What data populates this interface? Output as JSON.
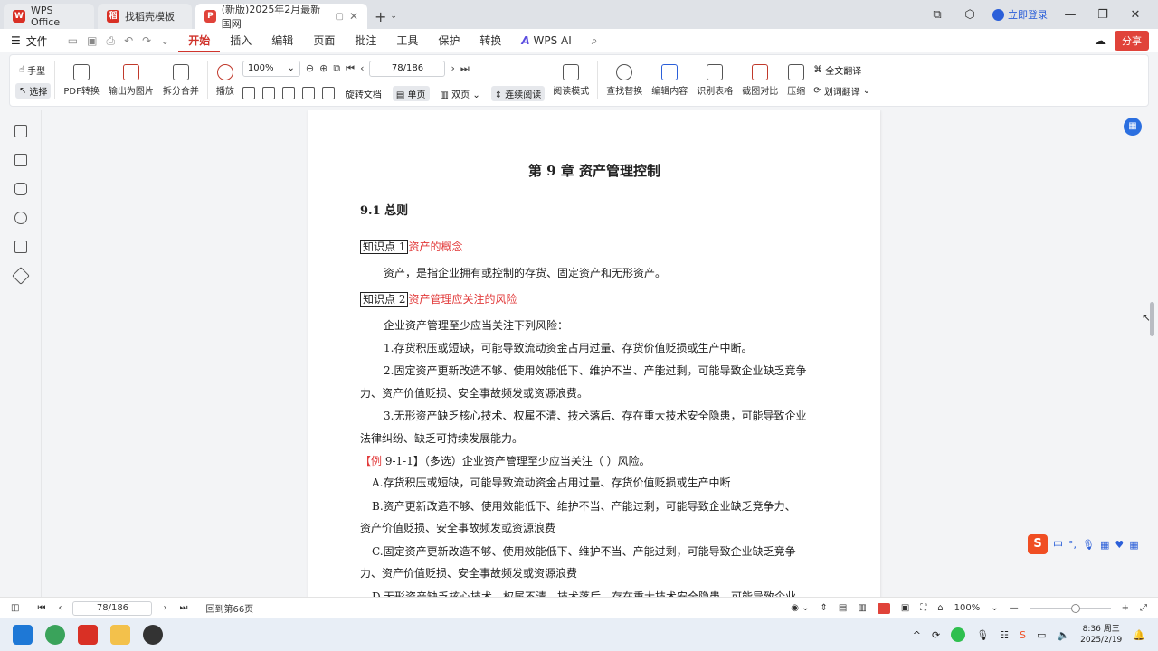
{
  "tabs": [
    {
      "label": "WPS Office",
      "logo": "W",
      "color": "#d93025"
    },
    {
      "label": "找稻壳模板",
      "logo": "稻",
      "color": "#d93025"
    },
    {
      "label": "(新版)2025年2月最新国网",
      "logo": "P",
      "color": "#e0433a"
    }
  ],
  "titlebar": {
    "login_label": "立即登录"
  },
  "menu": {
    "file_label": "文件",
    "items": [
      "开始",
      "插入",
      "编辑",
      "页面",
      "批注",
      "工具",
      "保护",
      "转换"
    ],
    "ai_label": "WPS AI",
    "share_label": "分享"
  },
  "ribbon": {
    "hand": "手型",
    "select": "选择",
    "pdf_convert": "PDF转换",
    "export_image": "输出为图片",
    "split_merge": "拆分合并",
    "play": "播放",
    "zoom": "100%",
    "page": "78/186",
    "rotate": "旋转文档",
    "single": "单页",
    "double": "双页",
    "continuous": "连续阅读",
    "read_mode": "阅读模式",
    "find_replace": "查找替换",
    "edit_content": "编辑内容",
    "recognize_table": "识别表格",
    "crop_compare": "截图对比",
    "compress": "压缩",
    "full_translate": "全文翻译",
    "word_translate": "划词翻译"
  },
  "doc": {
    "chapter": "第 9 章  资产管理控制",
    "section": "9.1  总则",
    "kp1_box": "知识点 1",
    "kp1_title": "资产的概念",
    "kp1_text": "资产，是指企业拥有或控制的存货、固定资产和无形资产。",
    "kp2_box": "知识点 2",
    "kp2_title": "资产管理应关注的风险",
    "l1": "企业资产管理至少应当关注下列风险：",
    "l2": "1.存货积压或短缺，可能导致流动资金占用过量、存货价值贬损或生产中断。",
    "l3a": "2.固定资产更新改造不够、使用效能低下、维护不当、产能过剩，可能导致企业缺乏竞争",
    "l3b": "力、资产价值贬损、安全事故频发或资源浪费。",
    "l4a": "3.无形资产缺乏核心技术、权属不清、技术落后、存在重大技术安全隐患，可能导致企业",
    "l4b": "法律纠纷、缺乏可持续发展能力。",
    "ex_tag": "【例",
    "ex_num": " 9-1-1】",
    "ex_text": "（多选）企业资产管理至少应当关注（        ）风险。",
    "oa": "A.存货积压或短缺，可能导致流动资金占用过量、存货价值贬损或生产中断",
    "ob1": "B.资产更新改造不够、使用效能低下、维护不当、产能过剩，可能导致企业缺乏竞争力、",
    "ob2": "资产价值贬损、安全事故频发或资源浪费",
    "oc1": "C.固定资产更新改造不够、使用效能低下、维护不当、产能过剩，可能导致企业缺乏竞争",
    "oc2": "力、资产价值贬损、安全事故频发或资源浪费",
    "od1": "D.无形资产缺乏核心技术、权属不清、技术落后、存在重大技术安全隐患，可能导致企业"
  },
  "ime": {
    "cn": "中",
    "dot": "°,"
  },
  "status": {
    "page": "78/186",
    "back_label": "回到第66页",
    "zoom": "100%"
  },
  "taskbar": {
    "time": "8:36 周三",
    "date": "2025/2/19"
  }
}
